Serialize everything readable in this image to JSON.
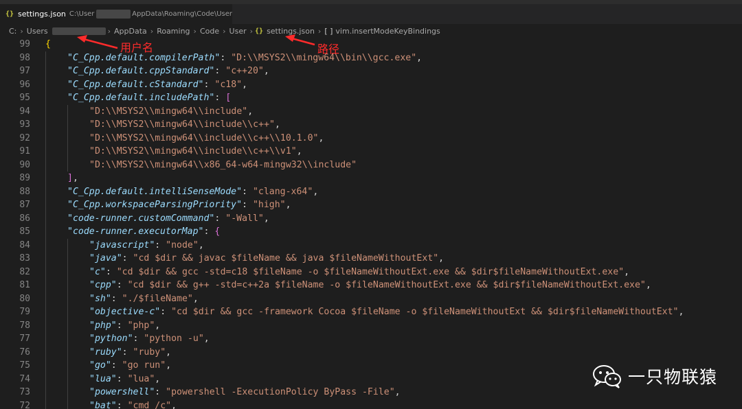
{
  "tab": {
    "icon": "json-braces-icon",
    "icon_glyph": "{}",
    "filename": "settings.json",
    "path_prefix": "C:\\User",
    "path_suffix": "AppData\\Roaming\\Code\\User"
  },
  "breadcrumb": {
    "items": [
      "C:",
      "Users",
      "AppData",
      "Roaming",
      "Code",
      "User"
    ],
    "file": "settings.json",
    "file_icon": "{}",
    "symbol_icon": "[ ]",
    "symbol": "vim.insertModeKeyBindings"
  },
  "annotations": {
    "username": "用户名",
    "path": "路径"
  },
  "watermark": {
    "text": "一只物联猿"
  },
  "colors": {
    "background": "#1e1e1e",
    "key": "#9cdcfe",
    "string": "#ce9178",
    "bracket_gold": "#ffd700",
    "bracket_purple": "#da70d6",
    "bracket_blue": "#179fff",
    "line_number": "#858585",
    "annotation": "#ff2b2b"
  },
  "lines": [
    {
      "n": "99",
      "indent": 0,
      "tokens": [
        {
          "t": "{",
          "c": "b1"
        }
      ]
    },
    {
      "n": "98",
      "indent": 1,
      "tokens": [
        {
          "t": "\"C_Cpp.default.compilerPath\"",
          "c": "k"
        },
        {
          "t": ": ",
          "c": "p"
        },
        {
          "t": "\"D:\\\\MSYS2\\\\mingw64\\\\bin\\\\gcc.exe\"",
          "c": "s"
        },
        {
          "t": ",",
          "c": "p"
        }
      ]
    },
    {
      "n": "97",
      "indent": 1,
      "tokens": [
        {
          "t": "\"C_Cpp.default.cppStandard\"",
          "c": "k"
        },
        {
          "t": ": ",
          "c": "p"
        },
        {
          "t": "\"c++20\"",
          "c": "s"
        },
        {
          "t": ",",
          "c": "p"
        }
      ]
    },
    {
      "n": "96",
      "indent": 1,
      "tokens": [
        {
          "t": "\"C_Cpp.default.cStandard\"",
          "c": "k"
        },
        {
          "t": ": ",
          "c": "p"
        },
        {
          "t": "\"c18\"",
          "c": "s"
        },
        {
          "t": ",",
          "c": "p"
        }
      ]
    },
    {
      "n": "95",
      "indent": 1,
      "tokens": [
        {
          "t": "\"C_Cpp.default.includePath\"",
          "c": "k"
        },
        {
          "t": ": ",
          "c": "p"
        },
        {
          "t": "[",
          "c": "b2"
        }
      ]
    },
    {
      "n": "94",
      "indent": 2,
      "tokens": [
        {
          "t": "\"D:\\\\MSYS2\\\\mingw64\\\\include\"",
          "c": "s"
        },
        {
          "t": ",",
          "c": "p"
        }
      ]
    },
    {
      "n": "93",
      "indent": 2,
      "tokens": [
        {
          "t": "\"D:\\\\MSYS2\\\\mingw64\\\\include\\\\c++\"",
          "c": "s"
        },
        {
          "t": ",",
          "c": "p"
        }
      ]
    },
    {
      "n": "92",
      "indent": 2,
      "tokens": [
        {
          "t": "\"D:\\\\MSYS2\\\\mingw64\\\\include\\\\c++\\\\10.1.0\"",
          "c": "s"
        },
        {
          "t": ",",
          "c": "p"
        }
      ]
    },
    {
      "n": "91",
      "indent": 2,
      "tokens": [
        {
          "t": "\"D:\\\\MSYS2\\\\mingw64\\\\include\\\\c++\\\\v1\"",
          "c": "s"
        },
        {
          "t": ",",
          "c": "p"
        }
      ]
    },
    {
      "n": "90",
      "indent": 2,
      "tokens": [
        {
          "t": "\"D:\\\\MSYS2\\\\mingw64\\\\x86_64-w64-mingw32\\\\include\"",
          "c": "s"
        }
      ]
    },
    {
      "n": "89",
      "indent": 1,
      "tokens": [
        {
          "t": "]",
          "c": "b2"
        },
        {
          "t": ",",
          "c": "p"
        }
      ]
    },
    {
      "n": "88",
      "indent": 1,
      "tokens": [
        {
          "t": "\"C_Cpp.default.intelliSenseMode\"",
          "c": "k"
        },
        {
          "t": ": ",
          "c": "p"
        },
        {
          "t": "\"clang-x64\"",
          "c": "s"
        },
        {
          "t": ",",
          "c": "p"
        }
      ]
    },
    {
      "n": "87",
      "indent": 1,
      "tokens": [
        {
          "t": "\"C_Cpp.workspaceParsingPriority\"",
          "c": "k"
        },
        {
          "t": ": ",
          "c": "p"
        },
        {
          "t": "\"high\"",
          "c": "s"
        },
        {
          "t": ",",
          "c": "p"
        }
      ]
    },
    {
      "n": "86",
      "indent": 1,
      "tokens": [
        {
          "t": "\"code-runner.customCommand\"",
          "c": "k"
        },
        {
          "t": ": ",
          "c": "p"
        },
        {
          "t": "\"-Wall\"",
          "c": "s"
        },
        {
          "t": ",",
          "c": "p"
        }
      ]
    },
    {
      "n": "85",
      "indent": 1,
      "tokens": [
        {
          "t": "\"code-runner.executorMap\"",
          "c": "k"
        },
        {
          "t": ": ",
          "c": "p"
        },
        {
          "t": "{",
          "c": "b2"
        }
      ]
    },
    {
      "n": "84",
      "indent": 2,
      "tokens": [
        {
          "t": "\"javascript\"",
          "c": "k"
        },
        {
          "t": ": ",
          "c": "p"
        },
        {
          "t": "\"node\"",
          "c": "s"
        },
        {
          "t": ",",
          "c": "p"
        }
      ]
    },
    {
      "n": "83",
      "indent": 2,
      "tokens": [
        {
          "t": "\"java\"",
          "c": "k"
        },
        {
          "t": ": ",
          "c": "p"
        },
        {
          "t": "\"cd $dir && javac $fileName && java $fileNameWithoutExt\"",
          "c": "s"
        },
        {
          "t": ",",
          "c": "p"
        }
      ]
    },
    {
      "n": "82",
      "indent": 2,
      "tokens": [
        {
          "t": "\"c\"",
          "c": "k"
        },
        {
          "t": ": ",
          "c": "p"
        },
        {
          "t": "\"cd $dir && gcc -std=c18 $fileName -o $fileNameWithoutExt.exe && $dir$fileNameWithoutExt.exe\"",
          "c": "s"
        },
        {
          "t": ",",
          "c": "p"
        }
      ]
    },
    {
      "n": "81",
      "indent": 2,
      "tokens": [
        {
          "t": "\"cpp\"",
          "c": "k"
        },
        {
          "t": ": ",
          "c": "p"
        },
        {
          "t": "\"cd $dir && g++ -std=c++2a $fileName -o $fileNameWithoutExt.exe && $dir$fileNameWithoutExt.exe\"",
          "c": "s"
        },
        {
          "t": ",",
          "c": "p"
        }
      ]
    },
    {
      "n": "80",
      "indent": 2,
      "tokens": [
        {
          "t": "\"sh\"",
          "c": "k"
        },
        {
          "t": ": ",
          "c": "p"
        },
        {
          "t": "\"./$fileName\"",
          "c": "s"
        },
        {
          "t": ",",
          "c": "p"
        }
      ]
    },
    {
      "n": "79",
      "indent": 2,
      "tokens": [
        {
          "t": "\"objective-c\"",
          "c": "k"
        },
        {
          "t": ": ",
          "c": "p"
        },
        {
          "t": "\"cd $dir && gcc -framework Cocoa $fileName -o $fileNameWithoutExt && $dir$fileNameWithoutExt\"",
          "c": "s"
        },
        {
          "t": ",",
          "c": "p"
        }
      ]
    },
    {
      "n": "78",
      "indent": 2,
      "tokens": [
        {
          "t": "\"php\"",
          "c": "k"
        },
        {
          "t": ": ",
          "c": "p"
        },
        {
          "t": "\"php\"",
          "c": "s"
        },
        {
          "t": ",",
          "c": "p"
        }
      ]
    },
    {
      "n": "77",
      "indent": 2,
      "tokens": [
        {
          "t": "\"python\"",
          "c": "k"
        },
        {
          "t": ": ",
          "c": "p"
        },
        {
          "t": "\"python -u\"",
          "c": "s"
        },
        {
          "t": ",",
          "c": "p"
        }
      ]
    },
    {
      "n": "76",
      "indent": 2,
      "tokens": [
        {
          "t": "\"ruby\"",
          "c": "k"
        },
        {
          "t": ": ",
          "c": "p"
        },
        {
          "t": "\"ruby\"",
          "c": "s"
        },
        {
          "t": ",",
          "c": "p"
        }
      ]
    },
    {
      "n": "75",
      "indent": 2,
      "tokens": [
        {
          "t": "\"go\"",
          "c": "k"
        },
        {
          "t": ": ",
          "c": "p"
        },
        {
          "t": "\"go run\"",
          "c": "s"
        },
        {
          "t": ",",
          "c": "p"
        }
      ]
    },
    {
      "n": "74",
      "indent": 2,
      "tokens": [
        {
          "t": "\"lua\"",
          "c": "k"
        },
        {
          "t": ": ",
          "c": "p"
        },
        {
          "t": "\"lua\"",
          "c": "s"
        },
        {
          "t": ",",
          "c": "p"
        }
      ]
    },
    {
      "n": "73",
      "indent": 2,
      "tokens": [
        {
          "t": "\"powershell\"",
          "c": "k"
        },
        {
          "t": ": ",
          "c": "p"
        },
        {
          "t": "\"powershell -ExecutionPolicy ByPass -File\"",
          "c": "s"
        },
        {
          "t": ",",
          "c": "p"
        }
      ]
    },
    {
      "n": "72",
      "indent": 2,
      "tokens": [
        {
          "t": "\"bat\"",
          "c": "k"
        },
        {
          "t": ": ",
          "c": "p"
        },
        {
          "t": "\"cmd /c\"",
          "c": "s"
        },
        {
          "t": ",",
          "c": "p"
        }
      ]
    }
  ]
}
